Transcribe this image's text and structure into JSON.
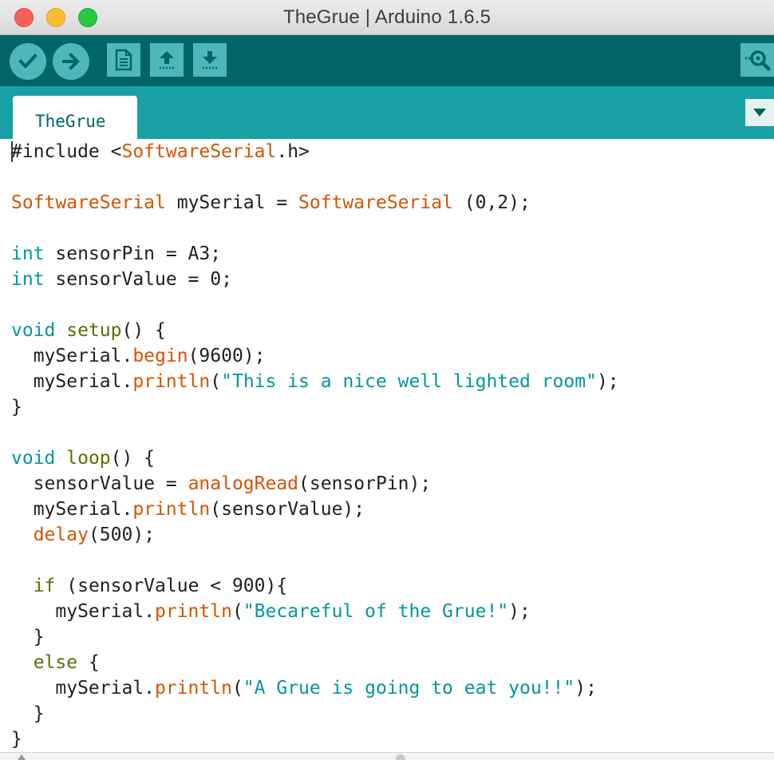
{
  "window": {
    "title": "TheGrue | Arduino 1.6.5"
  },
  "toolbar": {
    "buttons": [
      {
        "name": "verify",
        "icon": "check-icon"
      },
      {
        "name": "upload",
        "icon": "arrow-right-icon"
      },
      {
        "name": "new",
        "icon": "document-icon"
      },
      {
        "name": "open",
        "icon": "arrow-up-icon"
      },
      {
        "name": "save",
        "icon": "arrow-down-icon"
      },
      {
        "name": "serial-monitor",
        "icon": "magnifier-icon"
      }
    ],
    "colors": {
      "toolbar_bg": "#006468",
      "button_bg": "#4db7bb",
      "tabstrip_bg": "#17a1a5"
    }
  },
  "tabs": [
    {
      "label": "TheGrue",
      "active": true
    }
  ],
  "editor": {
    "colors": {
      "keyword": "#00979d",
      "function": "#d35400",
      "string": "#00979c",
      "control": "#5e6d03",
      "plain": "#1f1f1f"
    },
    "lines": [
      [
        {
          "t": "#include <",
          "c": "plain"
        },
        {
          "t": "SoftwareSerial",
          "c": "type"
        },
        {
          "t": ".h>",
          "c": "plain"
        }
      ],
      [],
      [
        {
          "t": "SoftwareSerial",
          "c": "type"
        },
        {
          "t": " mySerial = ",
          "c": "plain"
        },
        {
          "t": "SoftwareSerial",
          "c": "type"
        },
        {
          "t": " (0,2);",
          "c": "plain"
        }
      ],
      [],
      [
        {
          "t": "int",
          "c": "kw"
        },
        {
          "t": " sensorPin = A3;",
          "c": "plain"
        }
      ],
      [
        {
          "t": "int",
          "c": "kw"
        },
        {
          "t": " sensorValue = 0;",
          "c": "plain"
        }
      ],
      [],
      [
        {
          "t": "void",
          "c": "kw"
        },
        {
          "t": " ",
          "c": "plain"
        },
        {
          "t": "setup",
          "c": "ctl"
        },
        {
          "t": "() {",
          "c": "plain"
        }
      ],
      [
        {
          "t": "  mySerial.",
          "c": "plain"
        },
        {
          "t": "begin",
          "c": "fn"
        },
        {
          "t": "(9600);",
          "c": "plain"
        }
      ],
      [
        {
          "t": "  mySerial.",
          "c": "plain"
        },
        {
          "t": "println",
          "c": "fn"
        },
        {
          "t": "(",
          "c": "plain"
        },
        {
          "t": "\"This is a nice well lighted room\"",
          "c": "str"
        },
        {
          "t": ");",
          "c": "plain"
        }
      ],
      [
        {
          "t": "}",
          "c": "plain"
        }
      ],
      [],
      [
        {
          "t": "void",
          "c": "kw"
        },
        {
          "t": " ",
          "c": "plain"
        },
        {
          "t": "loop",
          "c": "ctl"
        },
        {
          "t": "() {",
          "c": "plain"
        }
      ],
      [
        {
          "t": "  sensorValue = ",
          "c": "plain"
        },
        {
          "t": "analogRead",
          "c": "fn"
        },
        {
          "t": "(sensorPin);",
          "c": "plain"
        }
      ],
      [
        {
          "t": "  mySerial.",
          "c": "plain"
        },
        {
          "t": "println",
          "c": "fn"
        },
        {
          "t": "(sensorValue);",
          "c": "plain"
        }
      ],
      [
        {
          "t": "  ",
          "c": "plain"
        },
        {
          "t": "delay",
          "c": "fn"
        },
        {
          "t": "(500);",
          "c": "plain"
        }
      ],
      [],
      [
        {
          "t": "  ",
          "c": "plain"
        },
        {
          "t": "if",
          "c": "ctl"
        },
        {
          "t": " (sensorValue < 900){",
          "c": "plain"
        }
      ],
      [
        {
          "t": "    mySerial.",
          "c": "plain"
        },
        {
          "t": "println",
          "c": "fn"
        },
        {
          "t": "(",
          "c": "plain"
        },
        {
          "t": "\"Becareful of the Grue!\"",
          "c": "str"
        },
        {
          "t": ");",
          "c": "plain"
        }
      ],
      [
        {
          "t": "  }",
          "c": "plain"
        }
      ],
      [
        {
          "t": "  ",
          "c": "plain"
        },
        {
          "t": "else",
          "c": "ctl"
        },
        {
          "t": " {",
          "c": "plain"
        }
      ],
      [
        {
          "t": "    mySerial.",
          "c": "plain"
        },
        {
          "t": "println",
          "c": "fn"
        },
        {
          "t": "(",
          "c": "plain"
        },
        {
          "t": "\"A Grue is going to eat you!!\"",
          "c": "str"
        },
        {
          "t": ");",
          "c": "plain"
        }
      ],
      [
        {
          "t": "  }",
          "c": "plain"
        }
      ],
      [
        {
          "t": "}",
          "c": "plain"
        }
      ]
    ]
  }
}
